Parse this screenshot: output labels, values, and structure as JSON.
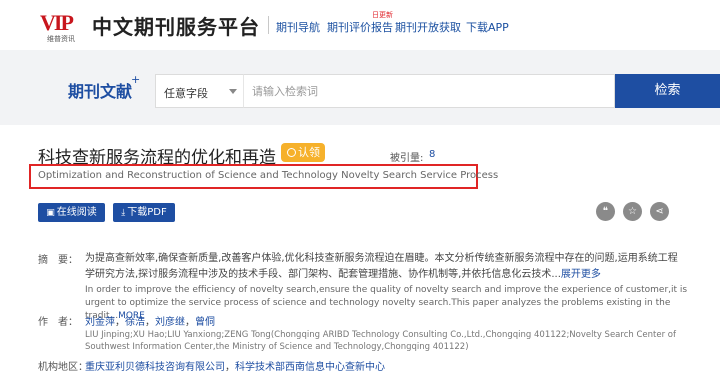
{
  "header": {
    "logo_mark": "VIP",
    "logo_sub": "维普资讯",
    "title": "中文期刊服务平台",
    "nav": [
      "期刊导航",
      "期刊评价报告",
      "期刊开放获取",
      "下载APP"
    ],
    "nav_new_tag": "日更新"
  },
  "search": {
    "label": "期刊文献",
    "label_sup": "+",
    "field": "任意字段",
    "placeholder": "请输入检索词",
    "button": "检索"
  },
  "article": {
    "title": "科技查新服务流程的优化和再造",
    "claim": "认领",
    "cite_label": "被引量:",
    "cite_count": "8",
    "en_title": "Optimization and Reconstruction of Science and Technology Novelty Search Service Process",
    "read_online": "在线阅读",
    "download_pdf": "下载PDF",
    "abstract_label": "摘　要：",
    "abstract_cn": "为提高查新效率,确保查新质量,改善客户体验,优化科技查新服务流程迫在眉睫。本文分析传统查新服务流程中存在的问题,运用系统工程学研究方法,探讨服务流程中涉及的技术手段、部门架构、配套管理措施、协作机制等,并依托信息化云技术...",
    "abstract_cn_more": "展开更多",
    "abstract_en": "In order to improve the efficiency of novelty search,ensure the quality of novelty search and improve the experience of customer,it is urgent to optimize the service process of science and technology novelty search.This paper analyzes the problems existing in the tradit...",
    "abstract_en_more": "MORE",
    "authors_label": "作　者：",
    "authors": [
      "刘金萍",
      "徐浩",
      "刘彦继",
      "曾侗"
    ],
    "authors_en": "LIU Jinping;XU Hao;LIU Yanxiong;ZENG Tong(Chongqing ARIBD Technology Consulting Co.,Ltd.,Chongqing 401122;Novelty Search Center of Southwest Information Center,the Ministry of Science and Technology,Chongqing 401122)",
    "orgs_label": "机构地区：",
    "orgs": [
      "重庆亚利贝德科技咨询有限公司",
      "科学技术部西南信息中心查新中心"
    ]
  },
  "colors": {
    "brand_blue": "#1e4ea2",
    "logo_red": "#c8161d",
    "badge_orange": "#f6b12b",
    "highlight_red": "#e02525"
  }
}
